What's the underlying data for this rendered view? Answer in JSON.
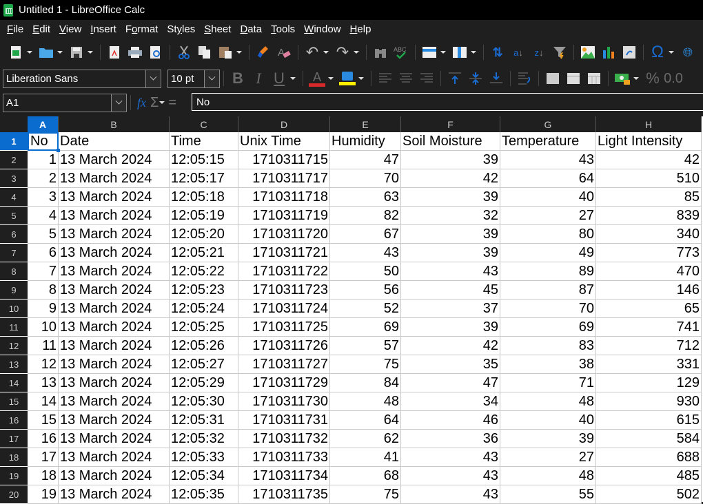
{
  "window": {
    "title": "Untitled 1 - LibreOffice Calc"
  },
  "menu": [
    {
      "label": "File",
      "mnemonic": "F",
      "rest": "ile"
    },
    {
      "label": "Edit",
      "mnemonic": "E",
      "rest": "dit"
    },
    {
      "label": "View",
      "mnemonic": "V",
      "rest": "iew"
    },
    {
      "label": "Insert",
      "mnemonic": "I",
      "rest": "nsert"
    },
    {
      "label": "Format",
      "pre": "F",
      "mnemonic": "o",
      "rest": "rmat"
    },
    {
      "label": "Styles",
      "pre": "St",
      "mnemonic": "y",
      "rest": "les"
    },
    {
      "label": "Sheet",
      "mnemonic": "S",
      "rest": "heet"
    },
    {
      "label": "Data",
      "mnemonic": "D",
      "rest": "ata"
    },
    {
      "label": "Tools",
      "mnemonic": "T",
      "rest": "ools"
    },
    {
      "label": "Window",
      "mnemonic": "W",
      "rest": "indow"
    },
    {
      "label": "Help",
      "mnemonic": "H",
      "rest": "elp"
    }
  ],
  "format_bar": {
    "font_name": "Liberation Sans",
    "font_size": "10 pt",
    "bold": "B",
    "italic": "I",
    "underline": "U",
    "font_color": "A",
    "percent": "%",
    "decimal": "0.0"
  },
  "formula_bar": {
    "name_box": "A1",
    "fx": "fx",
    "sigma": "Σ",
    "equals": "=",
    "content": "No"
  },
  "colors": {
    "accent": "#0b6cd0",
    "font_color_bar": "#d42a2a",
    "highlight_bar": "#ffee00"
  },
  "sheet": {
    "active_cell": "A1",
    "columns": [
      "A",
      "B",
      "C",
      "D",
      "E",
      "F",
      "G",
      "H"
    ],
    "row_numbers": [
      "1",
      "2",
      "3",
      "4",
      "5",
      "6",
      "7",
      "8",
      "9",
      "10",
      "11",
      "12",
      "13",
      "14",
      "15",
      "16",
      "17",
      "18",
      "19",
      "20"
    ],
    "headers": [
      "No",
      "Date",
      "Time",
      "Unix Time",
      "Humidity",
      "Soil Moisture",
      "Temperature",
      "Light Intensity"
    ],
    "rows": [
      [
        "1",
        "13 March 2024",
        "12:05:15",
        "1710311715",
        "47",
        "39",
        "43",
        "42"
      ],
      [
        "2",
        "13 March 2024",
        "12:05:17",
        "1710311717",
        "70",
        "42",
        "64",
        "510"
      ],
      [
        "3",
        "13 March 2024",
        "12:05:18",
        "1710311718",
        "63",
        "39",
        "40",
        "85"
      ],
      [
        "4",
        "13 March 2024",
        "12:05:19",
        "1710311719",
        "82",
        "32",
        "27",
        "839"
      ],
      [
        "5",
        "13 March 2024",
        "12:05:20",
        "1710311720",
        "67",
        "39",
        "80",
        "340"
      ],
      [
        "6",
        "13 March 2024",
        "12:05:21",
        "1710311721",
        "43",
        "39",
        "49",
        "773"
      ],
      [
        "7",
        "13 March 2024",
        "12:05:22",
        "1710311722",
        "50",
        "43",
        "89",
        "470"
      ],
      [
        "8",
        "13 March 2024",
        "12:05:23",
        "1710311723",
        "56",
        "45",
        "87",
        "146"
      ],
      [
        "9",
        "13 March 2024",
        "12:05:24",
        "1710311724",
        "52",
        "37",
        "70",
        "65"
      ],
      [
        "10",
        "13 March 2024",
        "12:05:25",
        "1710311725",
        "69",
        "39",
        "69",
        "741"
      ],
      [
        "11",
        "13 March 2024",
        "12:05:26",
        "1710311726",
        "57",
        "42",
        "83",
        "712"
      ],
      [
        "12",
        "13 March 2024",
        "12:05:27",
        "1710311727",
        "75",
        "35",
        "38",
        "331"
      ],
      [
        "13",
        "13 March 2024",
        "12:05:29",
        "1710311729",
        "84",
        "47",
        "71",
        "129"
      ],
      [
        "14",
        "13 March 2024",
        "12:05:30",
        "1710311730",
        "48",
        "34",
        "48",
        "930"
      ],
      [
        "15",
        "13 March 2024",
        "12:05:31",
        "1710311731",
        "64",
        "46",
        "40",
        "615"
      ],
      [
        "16",
        "13 March 2024",
        "12:05:32",
        "1710311732",
        "62",
        "36",
        "39",
        "584"
      ],
      [
        "17",
        "13 March 2024",
        "12:05:33",
        "1710311733",
        "41",
        "43",
        "27",
        "688"
      ],
      [
        "18",
        "13 March 2024",
        "12:05:34",
        "1710311734",
        "68",
        "43",
        "48",
        "485"
      ],
      [
        "19",
        "13 March 2024",
        "12:05:35",
        "1710311735",
        "75",
        "43",
        "55",
        "502"
      ]
    ]
  }
}
